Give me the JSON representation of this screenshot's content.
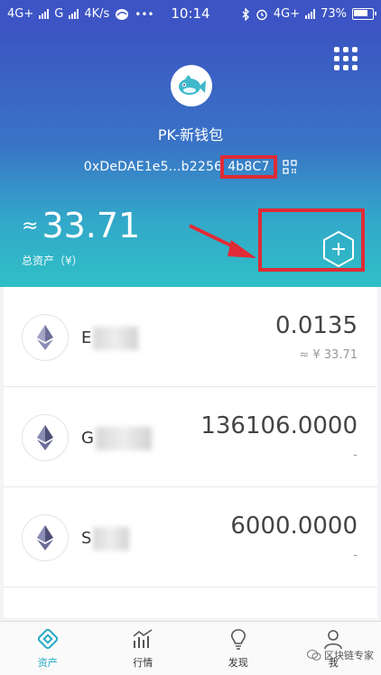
{
  "status_bar": {
    "network_left": "4G+",
    "network_g": "G",
    "speed": "4K/s",
    "time": "10:14",
    "network_right": "4G+",
    "battery": "73%"
  },
  "header": {
    "wallet_name": "PK-新钱包",
    "address_prefix": "0xDeDAE1e5...b2256",
    "address_highlight": "4b8C7",
    "approx_symbol": "≈",
    "total_value": "33.71",
    "total_label": "总资产（¥）"
  },
  "assets": [
    {
      "name": "E",
      "amount": "0.0135",
      "sub": "≈ ¥ 33.71"
    },
    {
      "name": "G",
      "amount": "136106.0000",
      "sub": "-"
    },
    {
      "name": "S",
      "amount": "6000.0000",
      "sub": "-"
    }
  ],
  "tabs": [
    {
      "label": "资产",
      "icon": "assets-icon",
      "active": true
    },
    {
      "label": "行情",
      "icon": "market-icon",
      "active": false
    },
    {
      "label": "发现",
      "icon": "discover-icon",
      "active": false
    },
    {
      "label": "我",
      "icon": "profile-icon",
      "active": false
    }
  ],
  "watermark": "区块链专家",
  "colors": {
    "header_top": "#3b55c2",
    "header_bottom": "#2fbfc6",
    "annotation_red": "#e02b36",
    "active_tab": "#23a9c4"
  }
}
